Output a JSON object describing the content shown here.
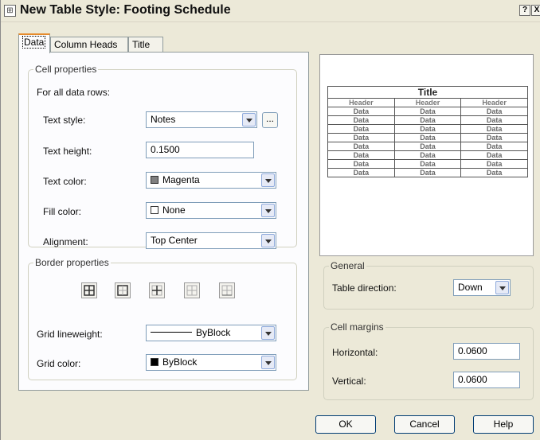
{
  "window": {
    "title": "New Table Style: Footing Schedule",
    "help_glyph": "?",
    "close_glyph": "X"
  },
  "tabs": [
    {
      "label": "Data"
    },
    {
      "label": "Column Heads"
    },
    {
      "label": "Title"
    }
  ],
  "cell_properties": {
    "legend": "Cell properties",
    "for_all": "For all data rows:",
    "text_style": {
      "label": "Text style:",
      "value": "Notes",
      "browse": "..."
    },
    "text_height": {
      "label": "Text height:",
      "value": "0.1500"
    },
    "text_color": {
      "label": "Text color:",
      "value": "Magenta",
      "swatch": "#808080"
    },
    "fill_color": {
      "label": "Fill color:",
      "value": "None",
      "swatch": "#ffffff"
    },
    "alignment": {
      "label": "Alignment:",
      "value": "Top Center"
    }
  },
  "border_properties": {
    "legend": "Border properties",
    "buttons": [
      "all-borders-icon",
      "outside-borders-icon",
      "inside-borders-icon",
      "no-borders-icon",
      "bottom-border-icon"
    ],
    "grid_lineweight": {
      "label": "Grid lineweight:",
      "value": "ByBlock"
    },
    "grid_color": {
      "label": "Grid color:",
      "value": "ByBlock",
      "swatch": "#000000"
    }
  },
  "preview": {
    "title": "Title",
    "headers": [
      "Header",
      "Header",
      "Header"
    ],
    "rows": [
      [
        "Data",
        "Data",
        "Data"
      ],
      [
        "Data",
        "Data",
        "Data"
      ],
      [
        "Data",
        "Data",
        "Data"
      ],
      [
        "Data",
        "Data",
        "Data"
      ],
      [
        "Data",
        "Data",
        "Data"
      ],
      [
        "Data",
        "Data",
        "Data"
      ],
      [
        "Data",
        "Data",
        "Data"
      ],
      [
        "Data",
        "Data",
        "Data"
      ]
    ]
  },
  "general": {
    "legend": "General",
    "table_direction": {
      "label": "Table direction:",
      "value": "Down"
    }
  },
  "cell_margins": {
    "legend": "Cell margins",
    "horizontal": {
      "label": "Horizontal:",
      "value": "0.0600"
    },
    "vertical": {
      "label": "Vertical:",
      "value": "0.0600"
    }
  },
  "buttons": {
    "ok": "OK",
    "cancel": "Cancel",
    "help": "Help"
  }
}
